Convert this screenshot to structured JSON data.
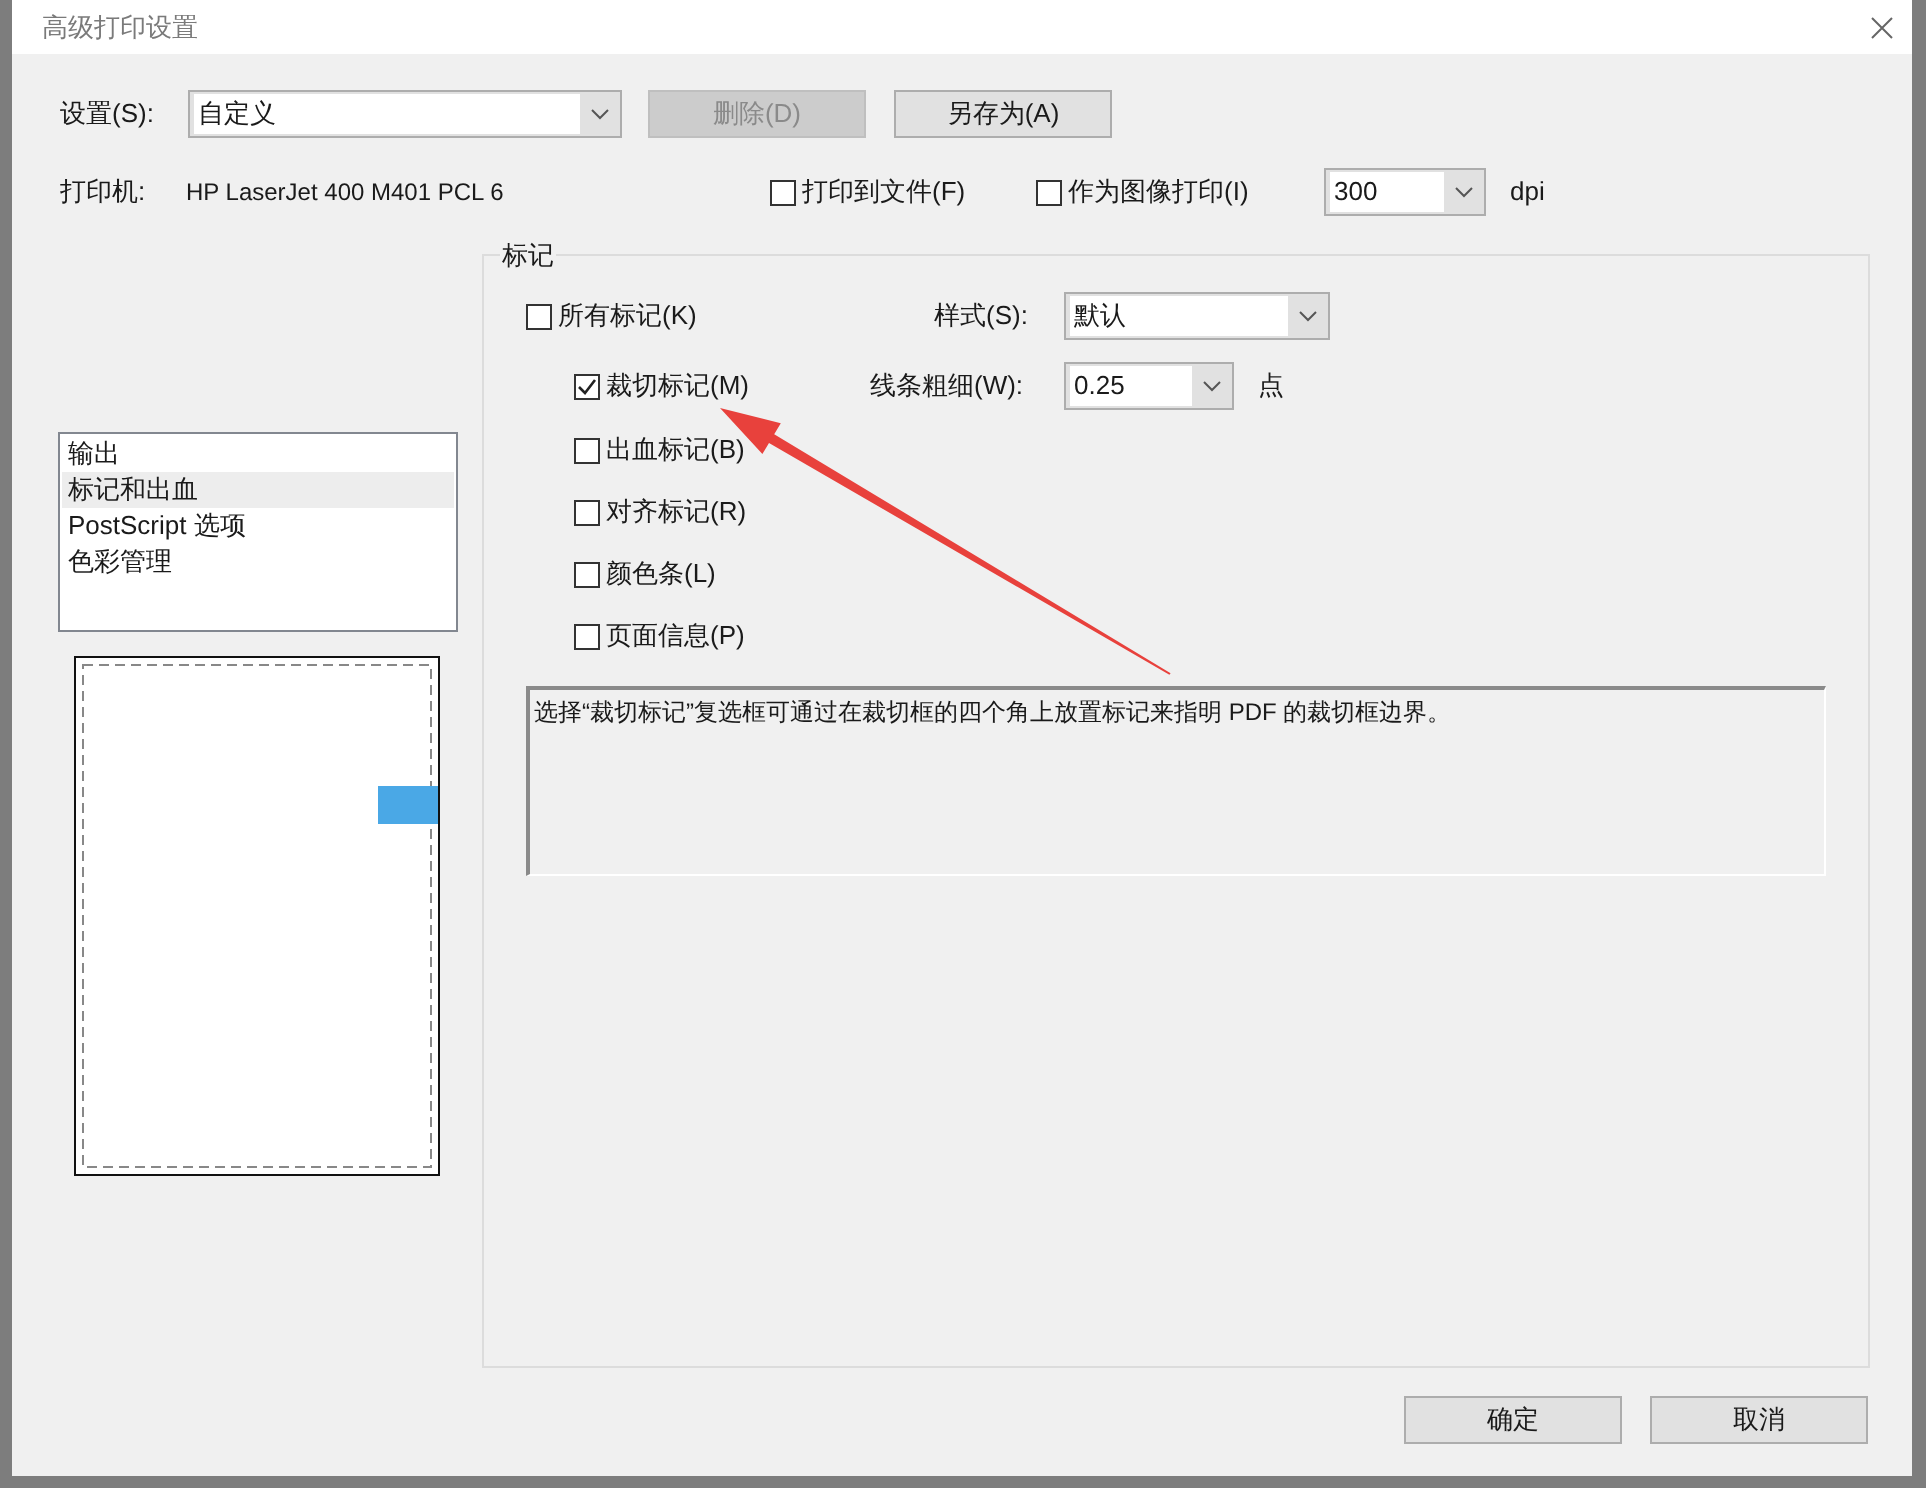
{
  "window": {
    "title": "高级打印设置"
  },
  "settings": {
    "label": "设置(S):",
    "value": "自定义"
  },
  "settings_buttons": [
    {
      "label": "删除(D)",
      "disabled": true
    },
    {
      "label": "另存为(A)",
      "disabled": false
    }
  ],
  "printer": {
    "label": "打印机:",
    "name": "HP LaserJet 400 M401 PCL 6"
  },
  "print_options": [
    {
      "label": "打印到文件(F)",
      "checked": false
    },
    {
      "label": "作为图像打印(I)",
      "checked": false
    }
  ],
  "resolution": {
    "value": "300",
    "unit": "dpi"
  },
  "sidebar": {
    "items": [
      {
        "label": "输出",
        "selected": false
      },
      {
        "label": "标记和出血",
        "selected": true
      },
      {
        "label": "PostScript 选项",
        "selected": false
      },
      {
        "label": "色彩管理",
        "selected": false
      }
    ]
  },
  "marks": {
    "title": "标记",
    "all_marks": {
      "label": "所有标记(K)",
      "checked": false
    },
    "style": {
      "label": "样式(S):",
      "value": "默认"
    },
    "line_weight": {
      "label": "线条粗细(W):",
      "value": "0.25",
      "unit": "点"
    },
    "items": [
      {
        "label": "裁切标记(M)",
        "checked": true
      },
      {
        "label": "出血标记(B)",
        "checked": false
      },
      {
        "label": "对齐标记(R)",
        "checked": false
      },
      {
        "label": "颜色条(L)",
        "checked": false
      },
      {
        "label": "页面信息(P)",
        "checked": false
      }
    ],
    "description": "选择“裁切标记”复选框可通过在裁切框的四个角上放置标记来指明 PDF 的裁切框边界。"
  },
  "footer_buttons": [
    {
      "label": "确定"
    },
    {
      "label": "取消"
    }
  ]
}
